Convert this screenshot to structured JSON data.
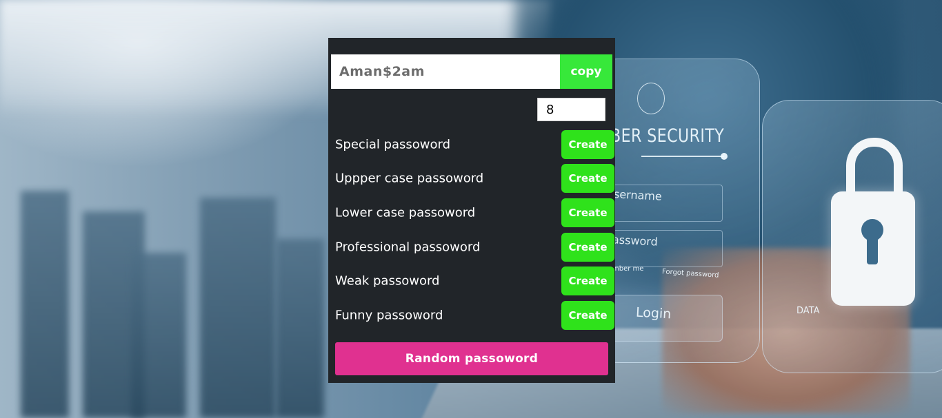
{
  "generator": {
    "password_value": "Aman$2am",
    "copy_label": "copy",
    "length_value": "8",
    "options": [
      {
        "label": "Special passoword",
        "button": "Create"
      },
      {
        "label": "Uppper case passoword",
        "button": "Create"
      },
      {
        "label": "Lower case passoword",
        "button": "Create"
      },
      {
        "label": "Professional passoword",
        "button": "Create"
      },
      {
        "label": "Weak passoword",
        "button": "Create"
      },
      {
        "label": "Funny passoword",
        "button": "Create"
      }
    ],
    "random_label": "Random passoword"
  },
  "background": {
    "cyber_text": "BER SECURITY",
    "username_text": "sername",
    "password_text": "assword",
    "remember_text": "mber me",
    "forgot_text": "Forgot password",
    "login_text": "Login",
    "data_text": "DATA"
  },
  "colors": {
    "panel_bg": "#212529",
    "copy_green": "#37e83a",
    "create_green": "#2fe21b",
    "random_pink": "#e03190"
  }
}
